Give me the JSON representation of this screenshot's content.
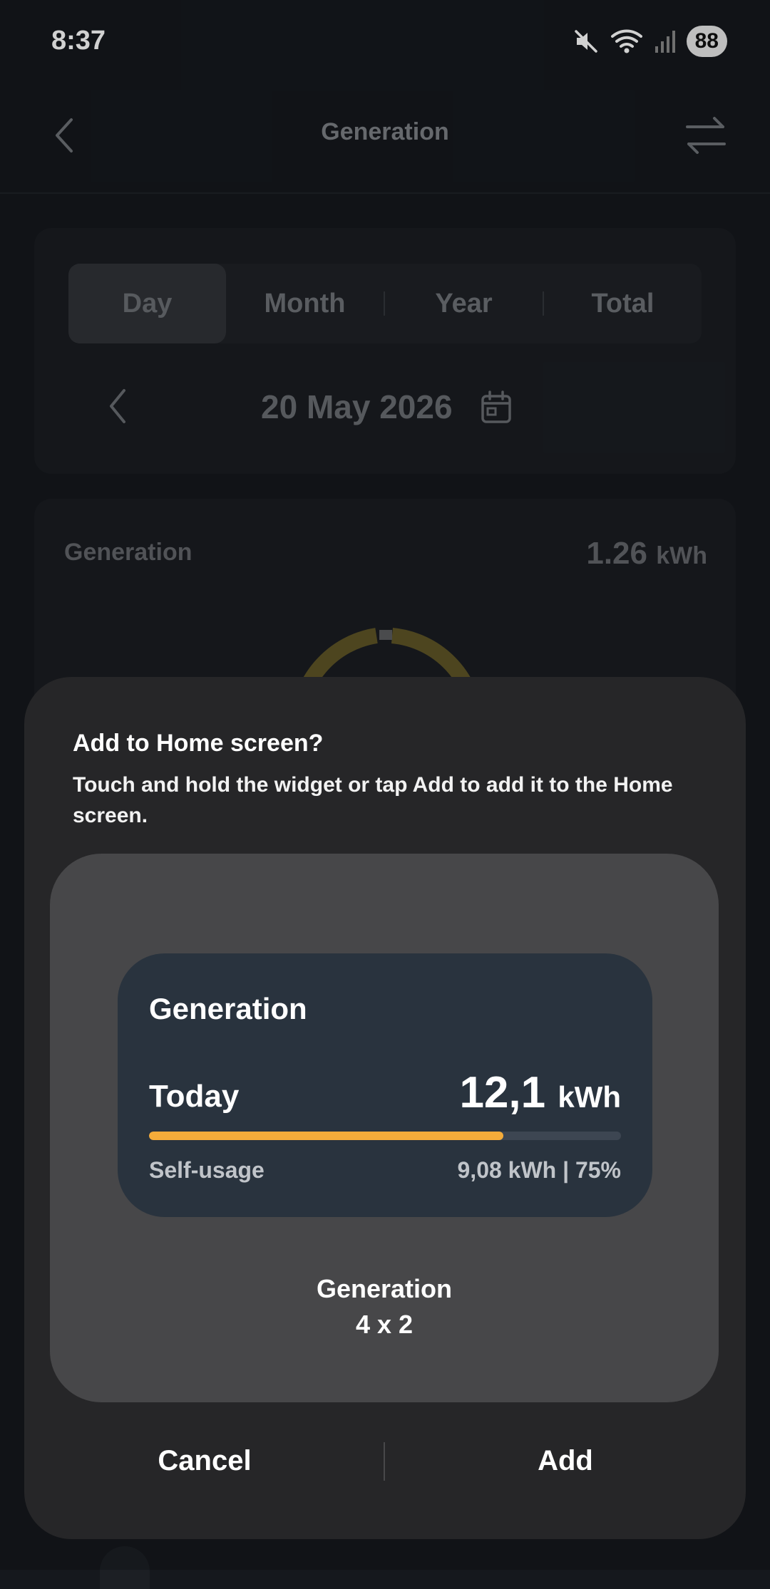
{
  "status_bar": {
    "time": "8:37",
    "battery": "88",
    "icons": [
      "mute-icon",
      "wifi-icon",
      "signal-icon"
    ]
  },
  "header": {
    "title": "Generation",
    "icons": [
      "back-chevron-icon",
      "swap-arrows-icon"
    ]
  },
  "period_selector": {
    "tabs": [
      {
        "label": "Day",
        "active": true
      },
      {
        "label": "Month",
        "active": false
      },
      {
        "label": "Year",
        "active": false
      },
      {
        "label": "Total",
        "active": false
      }
    ],
    "date": "20 May 2026"
  },
  "generation_card": {
    "label": "Generation",
    "value": "1.26",
    "unit": "kWh"
  },
  "dialog": {
    "title": "Add to Home screen?",
    "description": "Touch and hold the widget or tap Add to add it to the Home screen.",
    "widget": {
      "title": "Generation",
      "period_label": "Today",
      "value": "12,1",
      "unit": "kWh",
      "self_usage_label": "Self-usage",
      "self_usage_value": "9,08 kWh | 75%",
      "self_usage_fraction": 0.75
    },
    "widget_name": "Generation",
    "widget_size": "4 x 2",
    "cancel_label": "Cancel",
    "add_label": "Add"
  },
  "colors": {
    "background": "#15181d",
    "sheet": "#262628",
    "preview": "#474749",
    "widget": "#29333e",
    "accent": "#f5ac3a"
  }
}
